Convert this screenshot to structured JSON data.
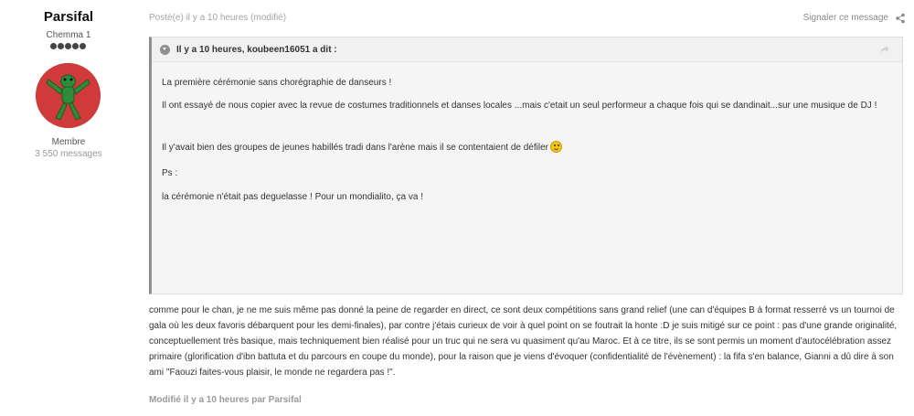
{
  "author": {
    "name": "Parsifal",
    "title": "Chemma 1",
    "rank_dots": 5,
    "group": "Membre",
    "posts": "3 550 messages"
  },
  "post": {
    "meta": "Posté(e) il y a 10 heures (modifié)",
    "report": "Signaler ce message",
    "quote": {
      "citation": "Il y a 10 heures, koubeen16051 a dit :",
      "paragraphs": [
        "La première cérémonie sans chorégraphie de danseurs !",
        "Il ont essayé de nous copier avec la revue de costumes traditionnels et danses locales ...mais c'etait un seul performeur a chaque fois qui se dandinait...sur une musique de DJ !",
        "Il y'avait bien des groupes de jeunes habillés tradi dans l'arène mais il se contentaient de défiler",
        "Ps :",
        "la cérémonie n'était pas deguelasse ! Pour un mondialito, ça va !"
      ]
    },
    "body": "comme pour le chan, je ne me suis même pas donné la peine de regarder en direct, ce sont deux compétitions sans grand relief (une can d'équipes B à format resserré vs un tournoi de gala où les deux favoris débarquent pour les demi-finales), par contre j'étais curieux de voir à quel point on se foutrait la honte :D je suis mitigé sur ce point : pas d'une grande originalité, conceptuellement très basique, mais techniquement bien réalisé pour un truc qui ne sera vu quasiment qu'au Maroc. Et à ce titre, ils se sont permis un moment d'autocélébration assez primaire (glorification d'ibn battuta et du parcours en coupe du monde), pour la raison que je viens d'évoquer (confidentialité de l'évènement) : la fifa s'en balance, Gianni a dû dire à son ami \"Faouzi faites-vous plaisir, le monde ne regardera pas !\".",
    "edited": "Modifié il y a 10 heures par Parsifal"
  },
  "icons": {
    "collapse": "chevron-down-icon",
    "goto": "share-arrow-icon",
    "share": "share-icon",
    "smiley": "smile-emoji-icon"
  }
}
